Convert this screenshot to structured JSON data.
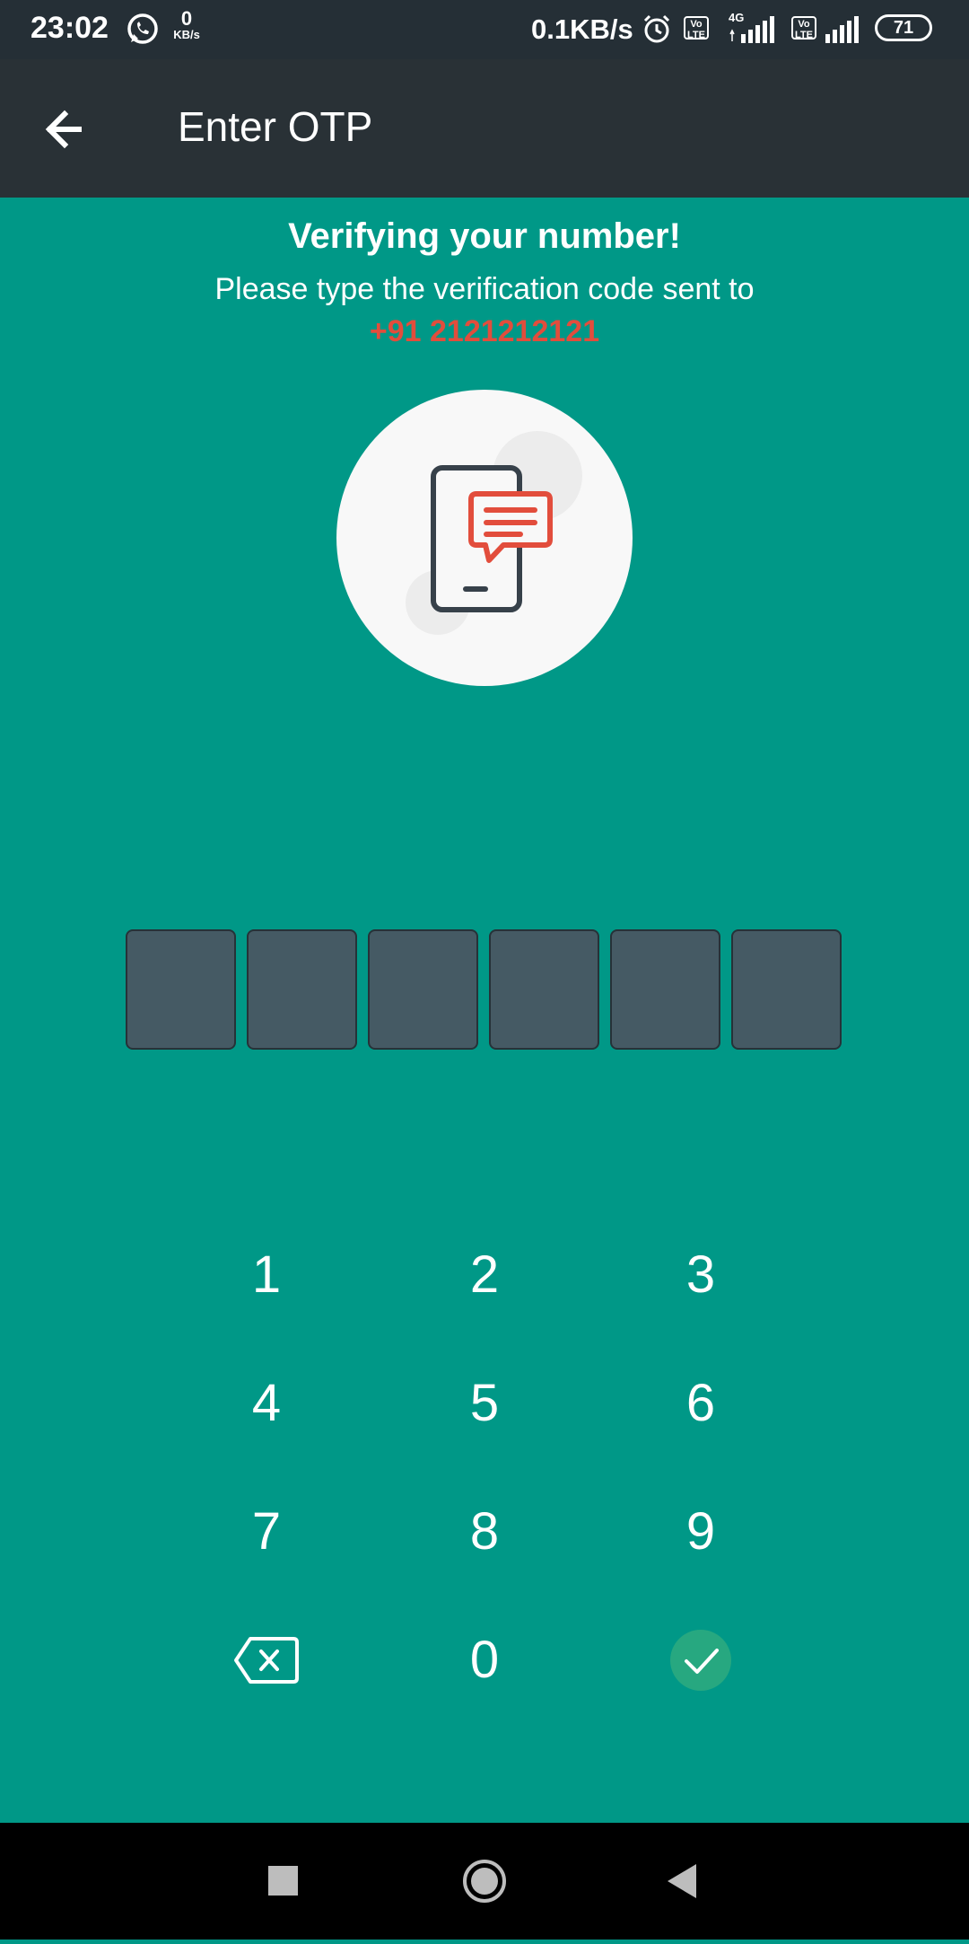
{
  "status_bar": {
    "time": "23:02",
    "net_speed_small_value": "0",
    "net_speed_small_unit": "KB/s",
    "net_speed": "0.1KB/s",
    "volte_label_1": "Vo LTE",
    "network_type": "4G",
    "volte_label_2": "Vo LTE",
    "battery_level": "71",
    "icons": [
      "whatsapp-icon",
      "alarm-icon",
      "volte-icon",
      "signal-icon",
      "volte-icon",
      "signal-icon",
      "battery-icon"
    ]
  },
  "app_bar": {
    "title": "Enter OTP",
    "back_icon": "arrow-left-icon"
  },
  "verification": {
    "heading": "Verifying your number!",
    "subtext": "Please type the verification code sent to",
    "phone_number": "+91 2121212121",
    "illustration_icon": "phone-message-icon"
  },
  "otp": {
    "digits": [
      "",
      "",
      "",
      "",
      "",
      ""
    ]
  },
  "keypad": {
    "keys": [
      "1",
      "2",
      "3",
      "4",
      "5",
      "6",
      "7",
      "8",
      "9",
      "0"
    ],
    "backspace_icon": "backspace-icon",
    "submit_icon": "check-icon"
  },
  "nav_bar": {
    "icons": [
      "recents-square-icon",
      "home-circle-icon",
      "back-triangle-icon"
    ]
  },
  "colors": {
    "background": "#009887",
    "app_bar": "#293136",
    "status_bar": "#252f36",
    "phone_number": "#e24d3c",
    "otp_box": "#455a64",
    "submit_button": "#27a880"
  }
}
